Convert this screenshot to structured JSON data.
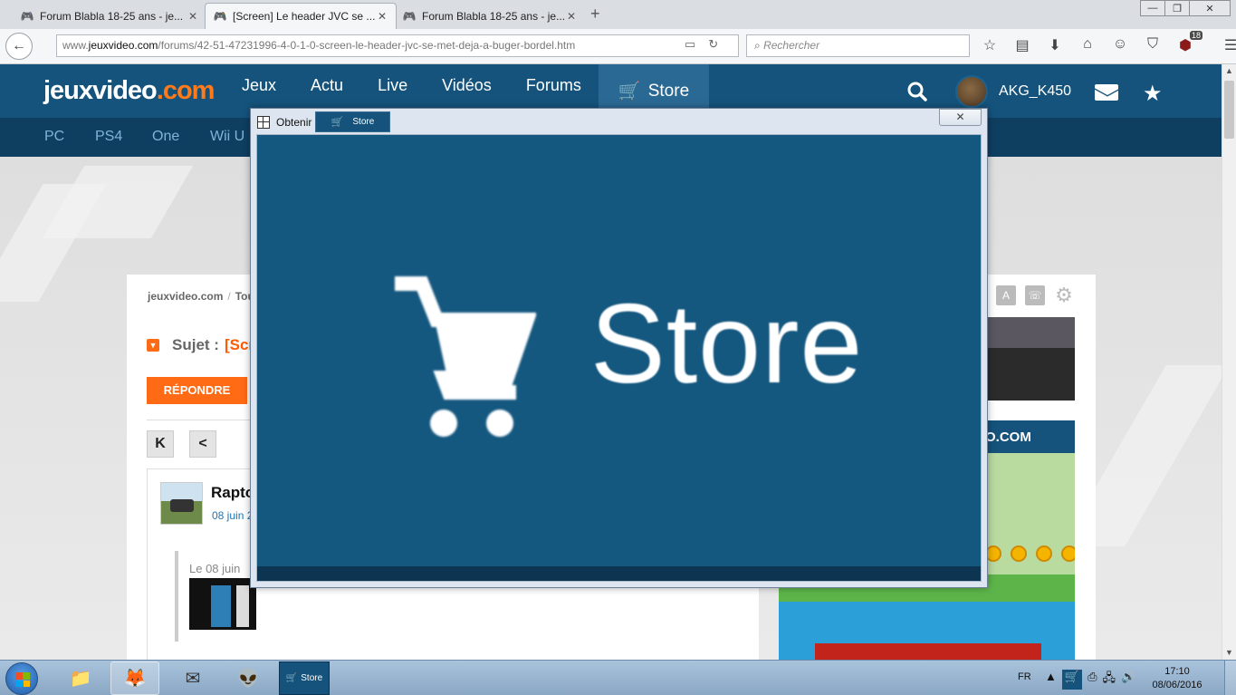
{
  "browser": {
    "tabs": [
      {
        "title": "Forum Blabla 18-25 ans - je...",
        "active": false
      },
      {
        "title": "[Screen] Le header JVC se ...",
        "active": true
      },
      {
        "title": "Forum Blabla 18-25 ans - je...",
        "active": false
      }
    ],
    "new_tab": "+",
    "url_prefix": "www.",
    "url_domain": "jeuxvideo.com",
    "url_path": "/forums/42-51-47231996-4-0-1-0-screen-le-header-jvc-se-met-deja-a-buger-bordel.htm",
    "search_placeholder": "Rechercher",
    "notification_badge": "18"
  },
  "site": {
    "logo_main": "jeuxvideo",
    "logo_tld": ".com",
    "nav": [
      "Jeux",
      "Actu",
      "Live",
      "Vidéos",
      "Forums"
    ],
    "store_label": "Store",
    "username": "AKG_K450",
    "subnav": [
      "PC",
      "PS4",
      "One",
      "Wii U"
    ]
  },
  "forum": {
    "breadcrumb_home": "jeuxvideo.com",
    "breadcrumb_sep": "/",
    "breadcrumb_next": "Tous",
    "subject_prefix": "Sujet :",
    "subject_title": "[Scr",
    "reply_button": "RÉPONDRE",
    "first_page": "K",
    "prev_page": "<",
    "post_author": "Rapto",
    "post_date": "08 juin 2",
    "quote_text": "Le 08 juin"
  },
  "sidebar": {
    "ad_banner_text": "O.COM"
  },
  "capture_window": {
    "title": "Obtenir",
    "tab_label": "Store",
    "close": "✕",
    "preview_text": "Store"
  },
  "taskbar": {
    "store_label": "Store",
    "lang": "FR",
    "time": "17:10",
    "date": "08/06/2016"
  },
  "colors": {
    "header_blue": "#15537c",
    "accent_orange": "#ff6a14"
  }
}
